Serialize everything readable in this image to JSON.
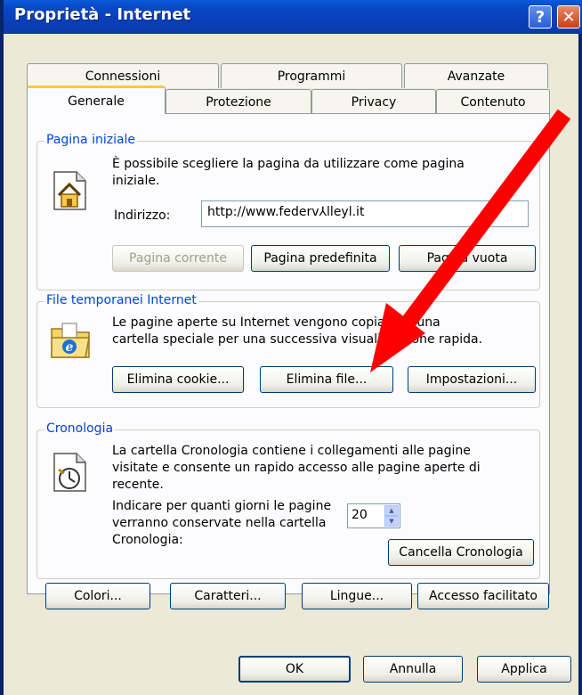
{
  "window": {
    "title": "Proprietà - Internet",
    "help_label": "?",
    "close_label": "✕"
  },
  "tabs": {
    "row1": [
      "Connessioni",
      "Programmi",
      "Avanzate"
    ],
    "row2": [
      "Generale",
      "Protezione",
      "Privacy",
      "Contenuto"
    ],
    "active": "Generale"
  },
  "home": {
    "title": "Pagina iniziale",
    "description_l1": "È possibile scegliere la pagina da utilizzare come pagina",
    "description_l2": "iniziale.",
    "address_label": "Indirizzo:",
    "address_value": "http://www.federv⅄lleyl.it",
    "btn_current": "Pagina corrente",
    "btn_default": "Pagina predefinita",
    "btn_blank": "Pagina vuota"
  },
  "temp": {
    "title": "File temporanei Internet",
    "description_l1": "Le pagine aperte su Internet vengono copiate in una",
    "description_l2": "cartella speciale per una successiva visualizzazione rapida.",
    "btn_cookie": "Elimina cookie...",
    "btn_files": "Elimina file...",
    "btn_settings": "Impostazioni..."
  },
  "history": {
    "title": "Cronologia",
    "description_l1": "La cartella Cronologia contiene i collegamenti alle pagine",
    "description_l2": "visitate e consente un rapido accesso alle pagine aperte di",
    "description_l3": "recente.",
    "days_label_l1": "Indicare per quanti giorni le pagine",
    "days_label_l2": "verranno conservate nella cartella",
    "days_label_l3": "Cronologia:",
    "days_value": "20",
    "btn_clear": "Cancella Cronologia"
  },
  "bottom_buttons": {
    "colors": "Colori...",
    "fonts": "Caratteri...",
    "languages": "Lingue...",
    "accessibility": "Accesso facilitato"
  },
  "dialog_buttons": {
    "ok": "OK",
    "cancel": "Annulla",
    "apply": "Applica"
  },
  "colors": {
    "title_bar": "#0a3fb8",
    "group_title": "#0046d5",
    "annotation_arrow": "#ff0000"
  }
}
